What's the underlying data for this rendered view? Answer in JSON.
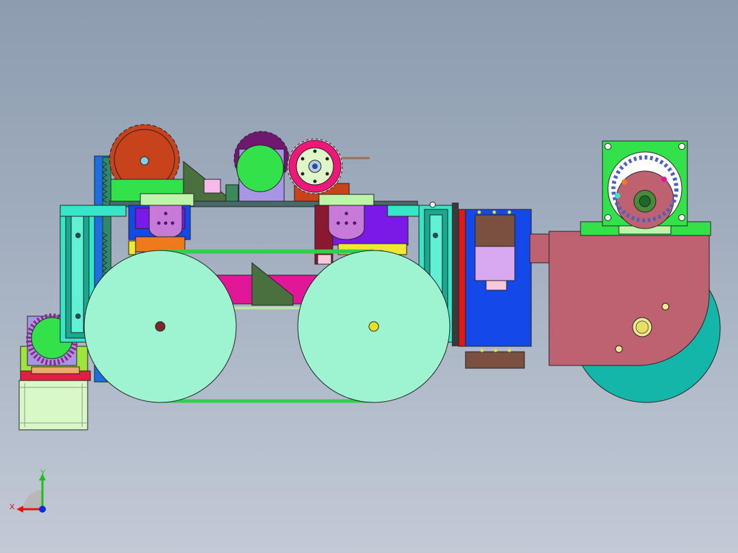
{
  "viewport": {
    "background_top": "#8d9cb0",
    "background_bottom": "#c3cad6",
    "view_orientation": "front"
  },
  "triad": {
    "x_label": "X",
    "y_label": "Y",
    "x_color": "#e81010",
    "y_color": "#18c018",
    "z_color": "#1028e0"
  },
  "colors": {
    "wheel": "#9ef3d0",
    "rear_wheel": "#13b6a8",
    "housing": "#be6272",
    "gear_orange": "#c8421c",
    "gear_purple": "#6e1870",
    "sprocket_pink": "#ef1777",
    "frame_teal": "#35e6c8",
    "motor_green": "#33e24a",
    "belt": "#2ed24a",
    "blue_panel": "#1548e8"
  }
}
